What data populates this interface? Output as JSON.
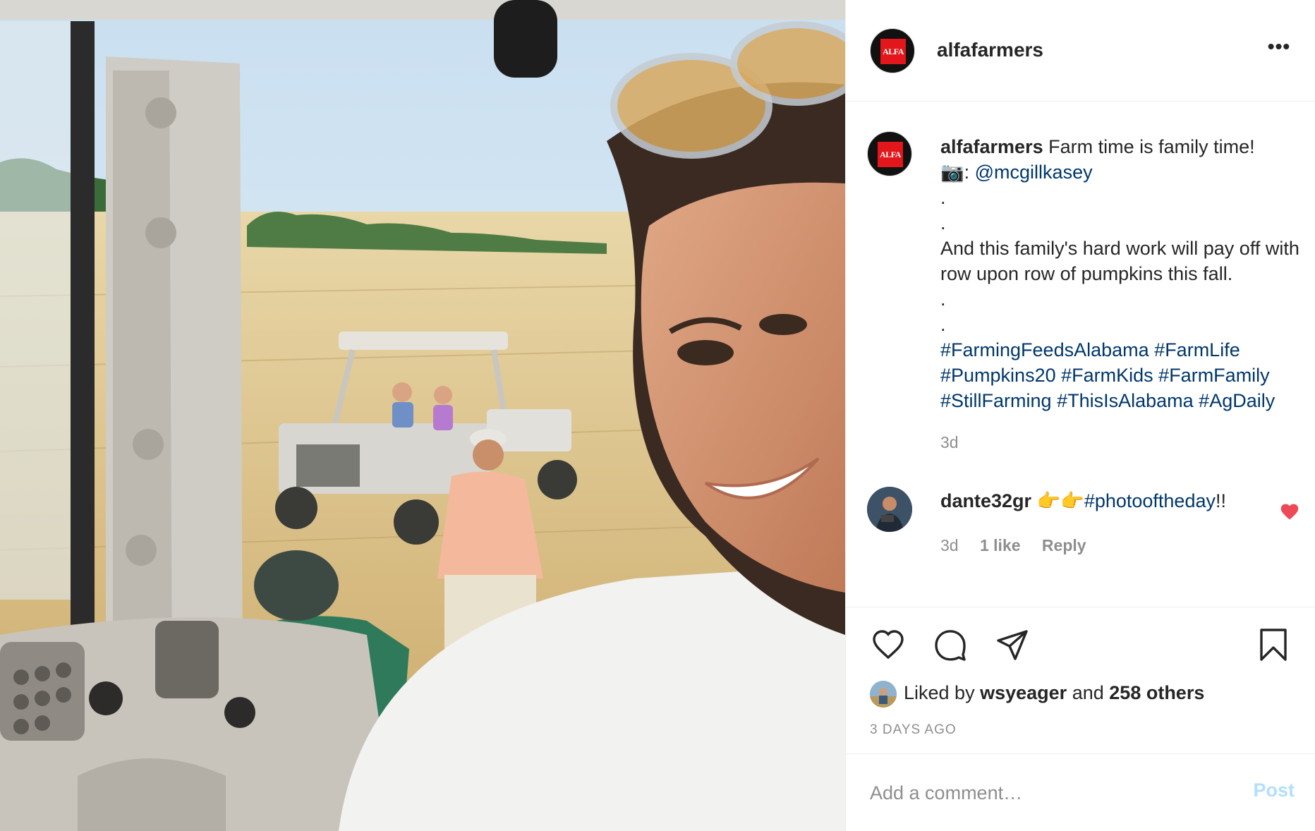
{
  "post": {
    "account": "alfafarmers",
    "avatar_logo_text": "ALFA",
    "more_icon": "•••"
  },
  "caption": {
    "username": "alfafarmers",
    "line1": "Farm time is family time!",
    "camera_emoji": "📷",
    "credit_sep": ": ",
    "credit": "@mcgillkasey",
    "dot": ".",
    "body": "And this family's hard work will pay off with row upon row of pumpkins this fall.",
    "hashtags": [
      "#FarmingFeedsAlabama",
      "#FarmLife",
      "#Pumpkins20",
      "#FarmKids",
      "#FarmFamily",
      "#StillFarming",
      "#ThisIsAlabama",
      "#AgDaily"
    ],
    "time": "3d"
  },
  "comment": {
    "username": "dante32gr",
    "emoji": "👉👉",
    "hashtag": "#photooftheday",
    "suffix": "!!",
    "time": "3d",
    "likes": "1 like",
    "reply": "Reply"
  },
  "likes": {
    "prefix": "Liked by",
    "user": "wsyeager",
    "and": "and",
    "others": "258 others"
  },
  "posted": "3 DAYS AGO",
  "add_comment": {
    "placeholder": "Add a comment…",
    "post_label": "Post"
  },
  "colors": {
    "link": "#00376b",
    "muted": "#8e8e8e",
    "heart": "#ed4956",
    "post_disabled": "#b2dffc",
    "brand_red": "#e2161b"
  }
}
